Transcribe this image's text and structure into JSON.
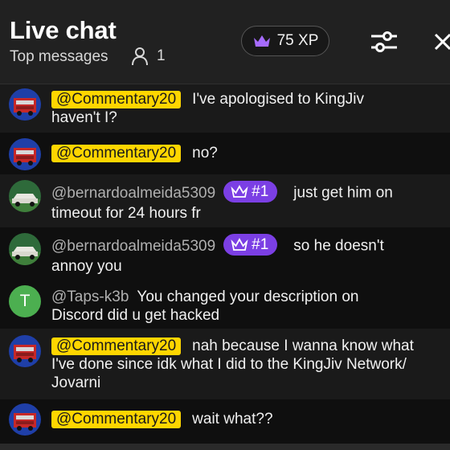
{
  "header": {
    "title": "Live chat",
    "subtitle": "Top messages",
    "viewer_count": "1",
    "xp": "75 XP"
  },
  "colors": {
    "accent_yellow": "#ffd600",
    "member_purple": "#7b3fe4",
    "crown_purple": "#a66bff",
    "avatar_green": "#4caf50"
  },
  "messages": [
    {
      "author": "@Commentary20",
      "text": "I've apologised to KingJiv",
      "text2": "haven't I?"
    },
    {
      "author": "@Commentary20",
      "text": "no?"
    },
    {
      "author": "@bernardoalmeida5309",
      "badge": "#1",
      "text": "just get him on",
      "text2": "timeout for 24 hours fr"
    },
    {
      "author": "@bernardoalmeida5309",
      "badge": "#1",
      "text": "so he doesn't",
      "text2": "annoy you"
    },
    {
      "author": "@Taps-k3b",
      "avatar_letter": "T",
      "text": "You changed your description on",
      "text2": "Discord did u get hacked"
    },
    {
      "author": "@Commentary20",
      "text": "nah because I wanna know what",
      "text2": "I've done since idk what I did to the KingJiv Network/",
      "text3": "Jovarni"
    },
    {
      "author": "@Commentary20",
      "text": "wait what??"
    }
  ]
}
